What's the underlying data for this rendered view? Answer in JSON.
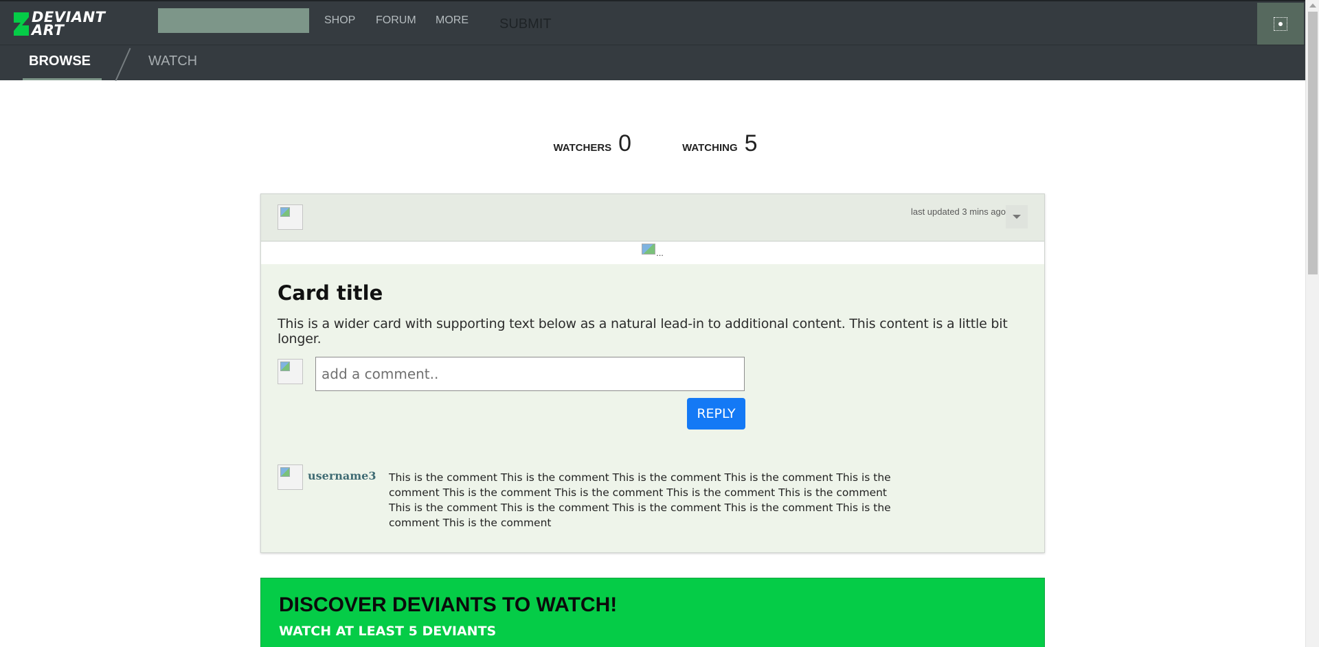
{
  "header": {
    "logo_text_line1": "DEVIANT",
    "logo_text_line2": "ART",
    "nav": [
      "SHOP",
      "FORUM",
      "MORE"
    ],
    "submit_label": "SUBMIT"
  },
  "subnav": {
    "tabs": [
      {
        "label": "BROWSE",
        "active": true
      },
      {
        "label": "WATCH",
        "active": false
      }
    ]
  },
  "stats": {
    "watchers_label": "WATCHERS",
    "watchers_value": "0",
    "watching_label": "WATCHING",
    "watching_value": "5"
  },
  "card": {
    "updated_text": "last updated 3 mins ago",
    "image_alt": "...",
    "title": "Card title",
    "text": "This is a wider card with supporting text below as a natural lead-in to additional content. This content is a little bit longer.",
    "comment_placeholder": "add a comment..",
    "reply_label": "REPLY",
    "comment": {
      "username": "username3",
      "text": "This is the comment This is the comment This is the comment This is the comment This is the comment This is the comment This is the comment This is the comment This is the comment This is the comment This is the comment This is the comment This is the comment This is the comment This is the comment"
    }
  },
  "discover": {
    "title": "DISCOVER DEVIANTS TO WATCH!",
    "subtitle": "WATCH AT LEAST 5 DEVIANTS"
  },
  "colors": {
    "header_bg": "#353b40",
    "accent_green": "#05cc47",
    "reply_blue": "#1479f5",
    "card_bg": "#eef4ea"
  },
  "icons": [
    "deviantart-logo-icon",
    "user-menu-icon",
    "chevron-down-icon",
    "avatar-image-icon"
  ]
}
